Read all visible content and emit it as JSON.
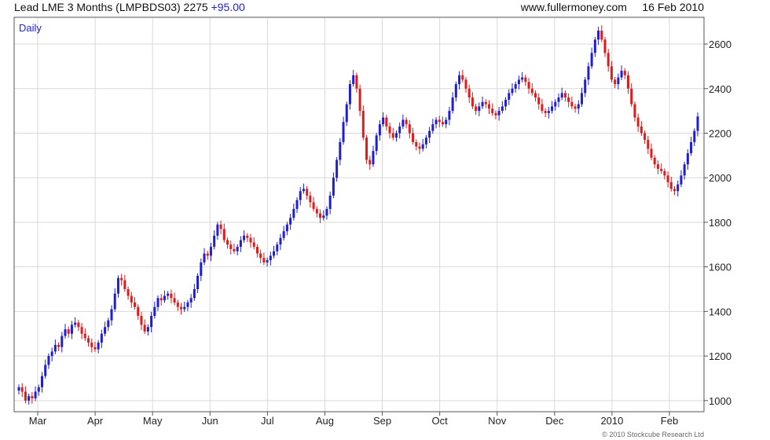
{
  "header": {
    "instrument": "Lead LME 3 Months (LMPBDS03)",
    "last": "2275",
    "change": "+95.00",
    "site": "www.fullermoney.com",
    "date": "16 Feb 2010"
  },
  "footer": {
    "copyright": "© 2010 Stockcube Research Ltd"
  },
  "colors": {
    "up": "#1f1fd0",
    "down": "#e01b1b",
    "grid": "#d9d9d9",
    "frame": "#555555"
  },
  "chart_data": {
    "type": "candlestick",
    "period_label": "Daily",
    "ylim": [
      950,
      2720
    ],
    "y_ticks": [
      1000,
      1200,
      1400,
      1600,
      1800,
      2000,
      2200,
      2400,
      2600
    ],
    "x_labels": [
      "Mar",
      "Apr",
      "May",
      "Jun",
      "Jul",
      "Aug",
      "Sep",
      "Oct",
      "Nov",
      "Dec",
      "2010",
      "Feb"
    ],
    "series": [
      {
        "values": [
          1060,
          1040,
          1000,
          1020,
          1010,
          1040,
          1060,
          1110,
          1160,
          1200,
          1220,
          1250,
          1240,
          1290,
          1320,
          1300,
          1340,
          1350,
          1330,
          1300,
          1280,
          1260,
          1240,
          1230,
          1260,
          1300,
          1330,
          1360,
          1410,
          1480,
          1550,
          1540,
          1500,
          1470,
          1440,
          1420,
          1380,
          1340,
          1310,
          1330,
          1380,
          1420,
          1460,
          1450,
          1470,
          1480,
          1460,
          1440,
          1420,
          1410,
          1420,
          1440,
          1460,
          1500,
          1560,
          1620,
          1660,
          1650,
          1690,
          1740,
          1790,
          1770,
          1720,
          1700,
          1680,
          1670,
          1690,
          1720,
          1740,
          1730,
          1710,
          1690,
          1660,
          1640,
          1620,
          1630,
          1650,
          1670,
          1700,
          1730,
          1760,
          1790,
          1820,
          1860,
          1900,
          1940,
          1950,
          1920,
          1890,
          1860,
          1840,
          1820,
          1830,
          1860,
          1920,
          2000,
          2080,
          2160,
          2250,
          2330,
          2420,
          2460,
          2400,
          2300,
          2180,
          2080,
          2060,
          2120,
          2190,
          2240,
          2270,
          2230,
          2200,
          2180,
          2200,
          2230,
          2260,
          2240,
          2200,
          2160,
          2140,
          2130,
          2150,
          2180,
          2210,
          2240,
          2260,
          2250,
          2240,
          2260,
          2300,
          2360,
          2420,
          2460,
          2440,
          2400,
          2360,
          2320,
          2300,
          2320,
          2340,
          2330,
          2310,
          2290,
          2280,
          2300,
          2320,
          2350,
          2380,
          2400,
          2420,
          2440,
          2450,
          2430,
          2400,
          2380,
          2360,
          2330,
          2300,
          2290,
          2300,
          2320,
          2340,
          2360,
          2380,
          2360,
          2340,
          2320,
          2310,
          2330,
          2380,
          2440,
          2500,
          2560,
          2620,
          2660,
          2620,
          2560,
          2500,
          2440,
          2420,
          2450,
          2480,
          2460,
          2400,
          2330,
          2270,
          2230,
          2200,
          2170,
          2130,
          2090,
          2060,
          2040,
          2030,
          2010,
          1980,
          1950,
          1940,
          1970,
          2010,
          2060,
          2110,
          2160,
          2210,
          2275
        ]
      }
    ]
  }
}
